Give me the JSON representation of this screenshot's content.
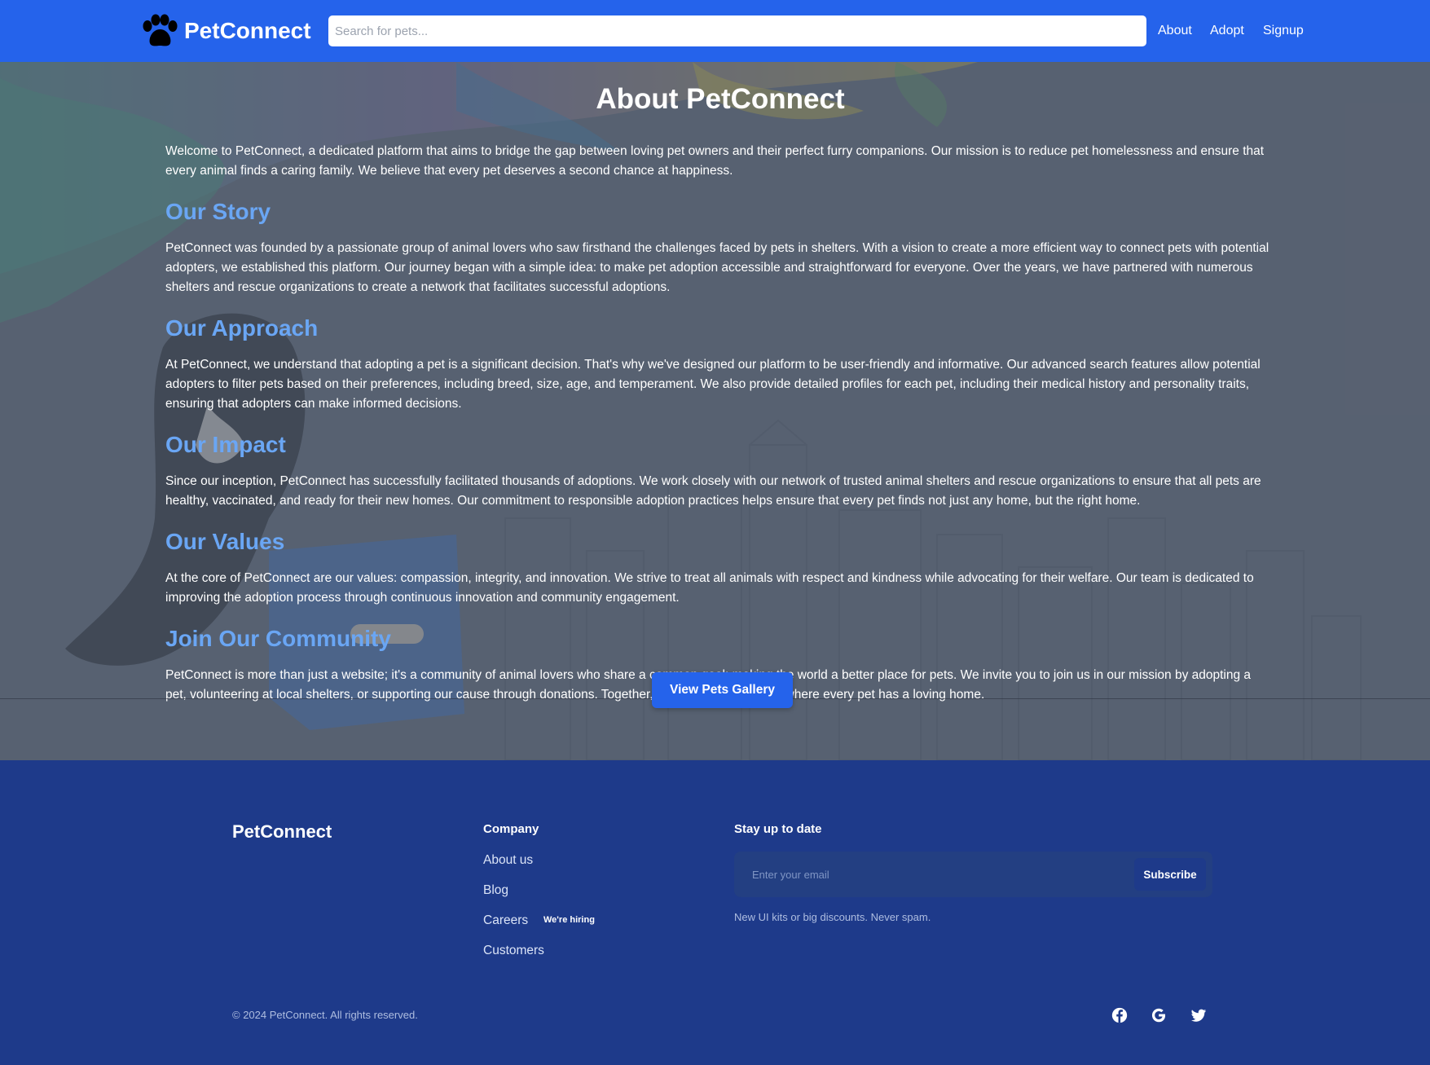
{
  "header": {
    "brand": "PetConnect",
    "search_placeholder": "Search for pets...",
    "nav": [
      "About",
      "Adopt",
      "Signup"
    ]
  },
  "main": {
    "title": "About PetConnect",
    "intro": "Welcome to PetConnect, a dedicated platform that aims to bridge the gap between loving pet owners and their perfect furry companions. Our mission is to reduce pet homelessness and ensure that every animal finds a caring family. We believe that every pet deserves a second chance at happiness.",
    "sections": [
      {
        "heading": "Our Story",
        "text": "PetConnect was founded by a passionate group of animal lovers who saw firsthand the challenges faced by pets in shelters. With a vision to create a more efficient way to connect pets with potential adopters, we established this platform. Our journey began with a simple idea: to make pet adoption accessible and straightforward for everyone. Over the years, we have partnered with numerous shelters and rescue organizations to create a network that facilitates successful adoptions."
      },
      {
        "heading": "Our Approach",
        "text": "At PetConnect, we understand that adopting a pet is a significant decision. That's why we've designed our platform to be user-friendly and informative. Our advanced search features allow potential adopters to filter pets based on their preferences, including breed, size, age, and temperament. We also provide detailed profiles for each pet, including their medical history and personality traits, ensuring that adopters can make informed decisions."
      },
      {
        "heading": "Our Impact",
        "text": "Since our inception, PetConnect has successfully facilitated thousands of adoptions. We work closely with our network of trusted animal shelters and rescue organizations to ensure that all pets are healthy, vaccinated, and ready for their new homes. Our commitment to responsible adoption practices helps ensure that every pet finds not just any home, but the right home."
      },
      {
        "heading": "Our Values",
        "text": "At the core of PetConnect are our values: compassion, integrity, and innovation. We strive to treat all animals with respect and kindness while advocating for their welfare. Our team is dedicated to improving the adoption process through continuous innovation and community engagement."
      },
      {
        "heading": "Join Our Community",
        "text": "PetConnect is more than just a website; it's a community of animal lovers who share a common goal: making the world a better place for pets. We invite you to join us in our mission by adopting a pet, volunteering at local shelters, or supporting our cause through donations. Together, we can create a future where every pet has a loving home."
      }
    ],
    "gallery_button": "View Pets Gallery"
  },
  "footer": {
    "brand": "PetConnect",
    "company_title": "Company",
    "links": [
      "About us",
      "Blog",
      "Careers",
      "Customers"
    ],
    "hiring_badge": "We're hiring",
    "newsletter_title": "Stay up to date",
    "email_placeholder": "Enter your email",
    "subscribe_label": "Subscribe",
    "note": "New UI kits or big discounts. Never spam.",
    "copyright": "© 2024 PetConnect. All rights reserved.",
    "social_icons": [
      "facebook-icon",
      "google-icon",
      "twitter-icon"
    ]
  },
  "colors": {
    "header_blue": "#2563eb",
    "footer_blue": "#1e3a8a",
    "heading_blue": "#6aa6f4",
    "overlay_gray": "#5b6473"
  }
}
